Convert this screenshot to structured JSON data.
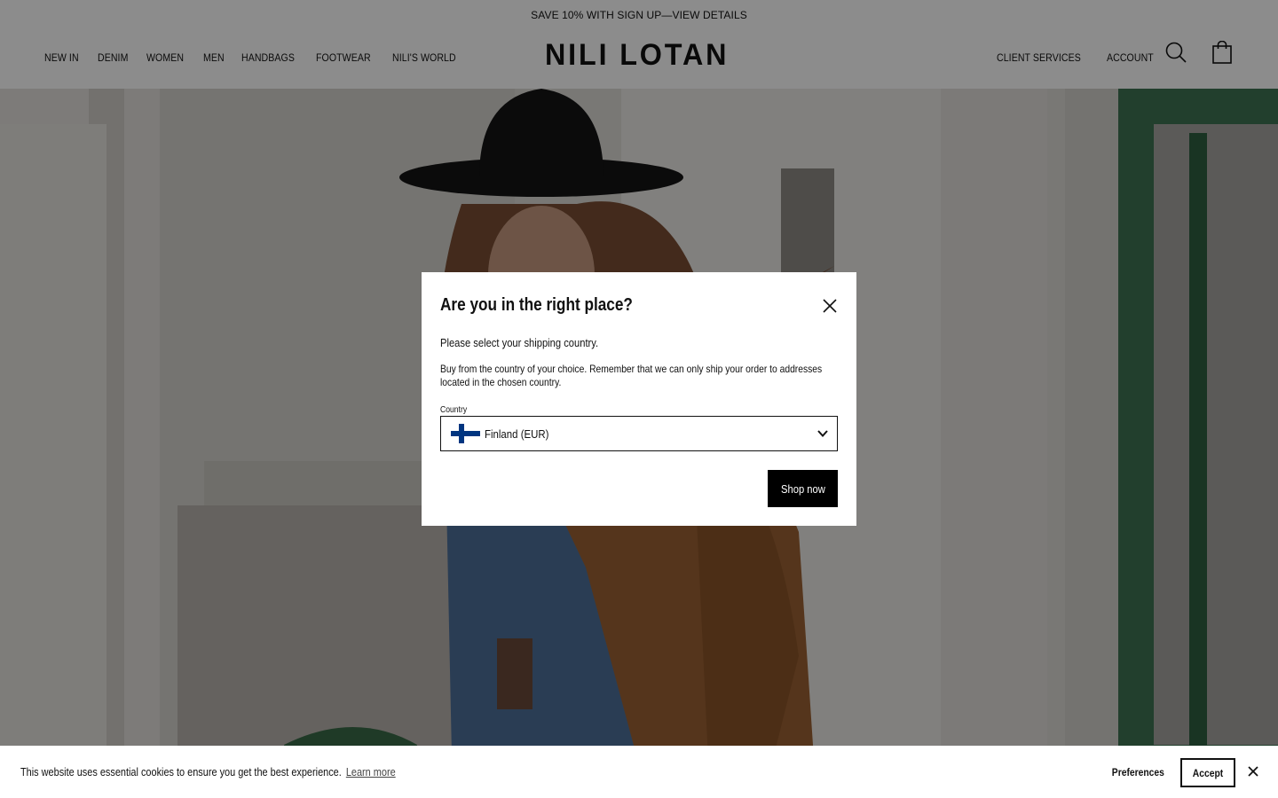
{
  "announcement": {
    "text": "SAVE 10% WITH SIGN UP—VIEW DETAILS"
  },
  "header": {
    "logo": "NILI LOTAN",
    "nav_left": [
      {
        "label": "NEW IN"
      },
      {
        "label": "DENIM"
      },
      {
        "label": "WOMEN"
      },
      {
        "label": "MEN"
      },
      {
        "label": "HANDBAGS"
      },
      {
        "label": "FOOTWEAR"
      },
      {
        "label": "NILI'S WORLD"
      }
    ],
    "nav_right": [
      {
        "label": "CLIENT SERVICES"
      },
      {
        "label": "ACCOUNT"
      }
    ],
    "icons": [
      "search-icon",
      "shopping-bag-icon"
    ]
  },
  "modal": {
    "title": "Are you in the right place?",
    "subtitle": "Please select your shipping country.",
    "body": "Buy from the country of your choice. Remember that we can only ship your order to addresses located in the chosen country.",
    "country_label": "Country",
    "selected_country": "Finland (EUR)",
    "flag_icon": "finland-flag-icon",
    "shop_button": "Shop now",
    "close_icon": "close-icon"
  },
  "cookie_bar": {
    "text": "This website uses essential cookies to ensure you get the best experience.",
    "learn_more": "Learn more",
    "preferences": "Preferences",
    "accept": "Accept",
    "close_icon": "close-icon"
  },
  "colors": {
    "overlay": "#000000",
    "overlay_opacity": 0.45,
    "button_bg": "#000000",
    "flag_blue": "#003580"
  }
}
